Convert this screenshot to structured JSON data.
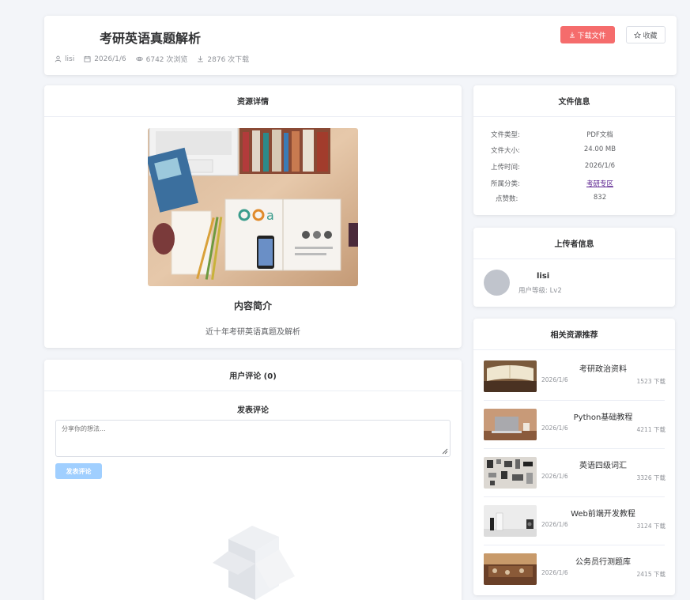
{
  "header": {
    "title": "考研英语真题解析",
    "author": "lisi",
    "date": "2026/1/6",
    "views": "6742 次浏览",
    "downloads": "2876 次下载",
    "download_label": "下载文件",
    "favorite_label": "收藏"
  },
  "detail": {
    "heading": "资源详情",
    "intro_title": "内容简介",
    "intro_text": "近十年考研英语真题及解析"
  },
  "comments": {
    "heading": "用户评论 (0)",
    "post_title": "发表评论",
    "placeholder": "分享你的想法...",
    "post_label": "发表评论"
  },
  "file_info": {
    "heading": "文件信息",
    "rows": [
      {
        "key": "文件类型:",
        "value": "PDF文档"
      },
      {
        "key": "文件大小:",
        "value": "24.00 MB"
      },
      {
        "key": "上传时间:",
        "value": "2026/1/6"
      },
      {
        "key": "所属分类:",
        "value": "考研专区"
      },
      {
        "key": "点赞数:",
        "value": "832"
      }
    ]
  },
  "uploader": {
    "heading": "上传者信息",
    "name": "lisi",
    "level": "用户等级: Lv2"
  },
  "related": {
    "heading": "相关资源推荐",
    "items": [
      {
        "title": "考研政治资料",
        "date": "2026/1/6",
        "downloads": "1523 下载"
      },
      {
        "title": "Python基础教程",
        "date": "2026/1/6",
        "downloads": "4211 下载"
      },
      {
        "title": "英语四级词汇",
        "date": "2026/1/6",
        "downloads": "3326 下载"
      },
      {
        "title": "Web前端开发教程",
        "date": "2026/1/6",
        "downloads": "3124 下载"
      },
      {
        "title": "公务员行测题库",
        "date": "2026/1/6",
        "downloads": "2415 下载"
      }
    ]
  },
  "colors": {
    "danger": "#f56c6c",
    "primary_light": "#a0cfff",
    "link": "#551a8b"
  }
}
